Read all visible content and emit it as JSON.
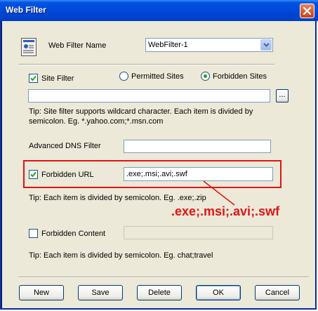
{
  "window": {
    "title": "Web Filter"
  },
  "form": {
    "filter_name_label": "Web Filter Name",
    "filter_name_value": "WebFilter-1",
    "site_filter_label": "Site Filter",
    "site_filter_checked": true,
    "permitted_sites_label": "Permitted Sites",
    "forbidden_sites_label": "Forbidden Sites",
    "site_filter_value": "",
    "browse_label": "...",
    "site_tip_line1": "Tip: Site filter supports wildcard character. Each item is divided by",
    "site_tip_line2": "semicolon. Eg. *.yahoo.com;*.msn.com",
    "dns_label": "Advanced DNS Filter",
    "dns_value": "",
    "forbidden_url_label": "Forbidden URL",
    "forbidden_url_checked": true,
    "forbidden_url_value": ".exe;.msi;.avi;.swf",
    "url_tip": "Tip: Each item is divided by semicolon. Eg. .exe;.zip",
    "forbidden_content_label": "Forbidden Content",
    "forbidden_content_checked": false,
    "forbidden_content_value": "",
    "content_tip": "Tip: Each item is divided by semicolon. Eg. chat;travel"
  },
  "annotation": {
    "text": ".exe;.msi;.avi;.swf",
    "color": "#e01414"
  },
  "buttons": {
    "new": "New",
    "save": "Save",
    "delete": "Delete",
    "ok": "OK",
    "cancel": "Cancel"
  },
  "icons": {
    "close": "close-icon",
    "document": "document-icon",
    "dropdown": "chevron-down-icon"
  }
}
